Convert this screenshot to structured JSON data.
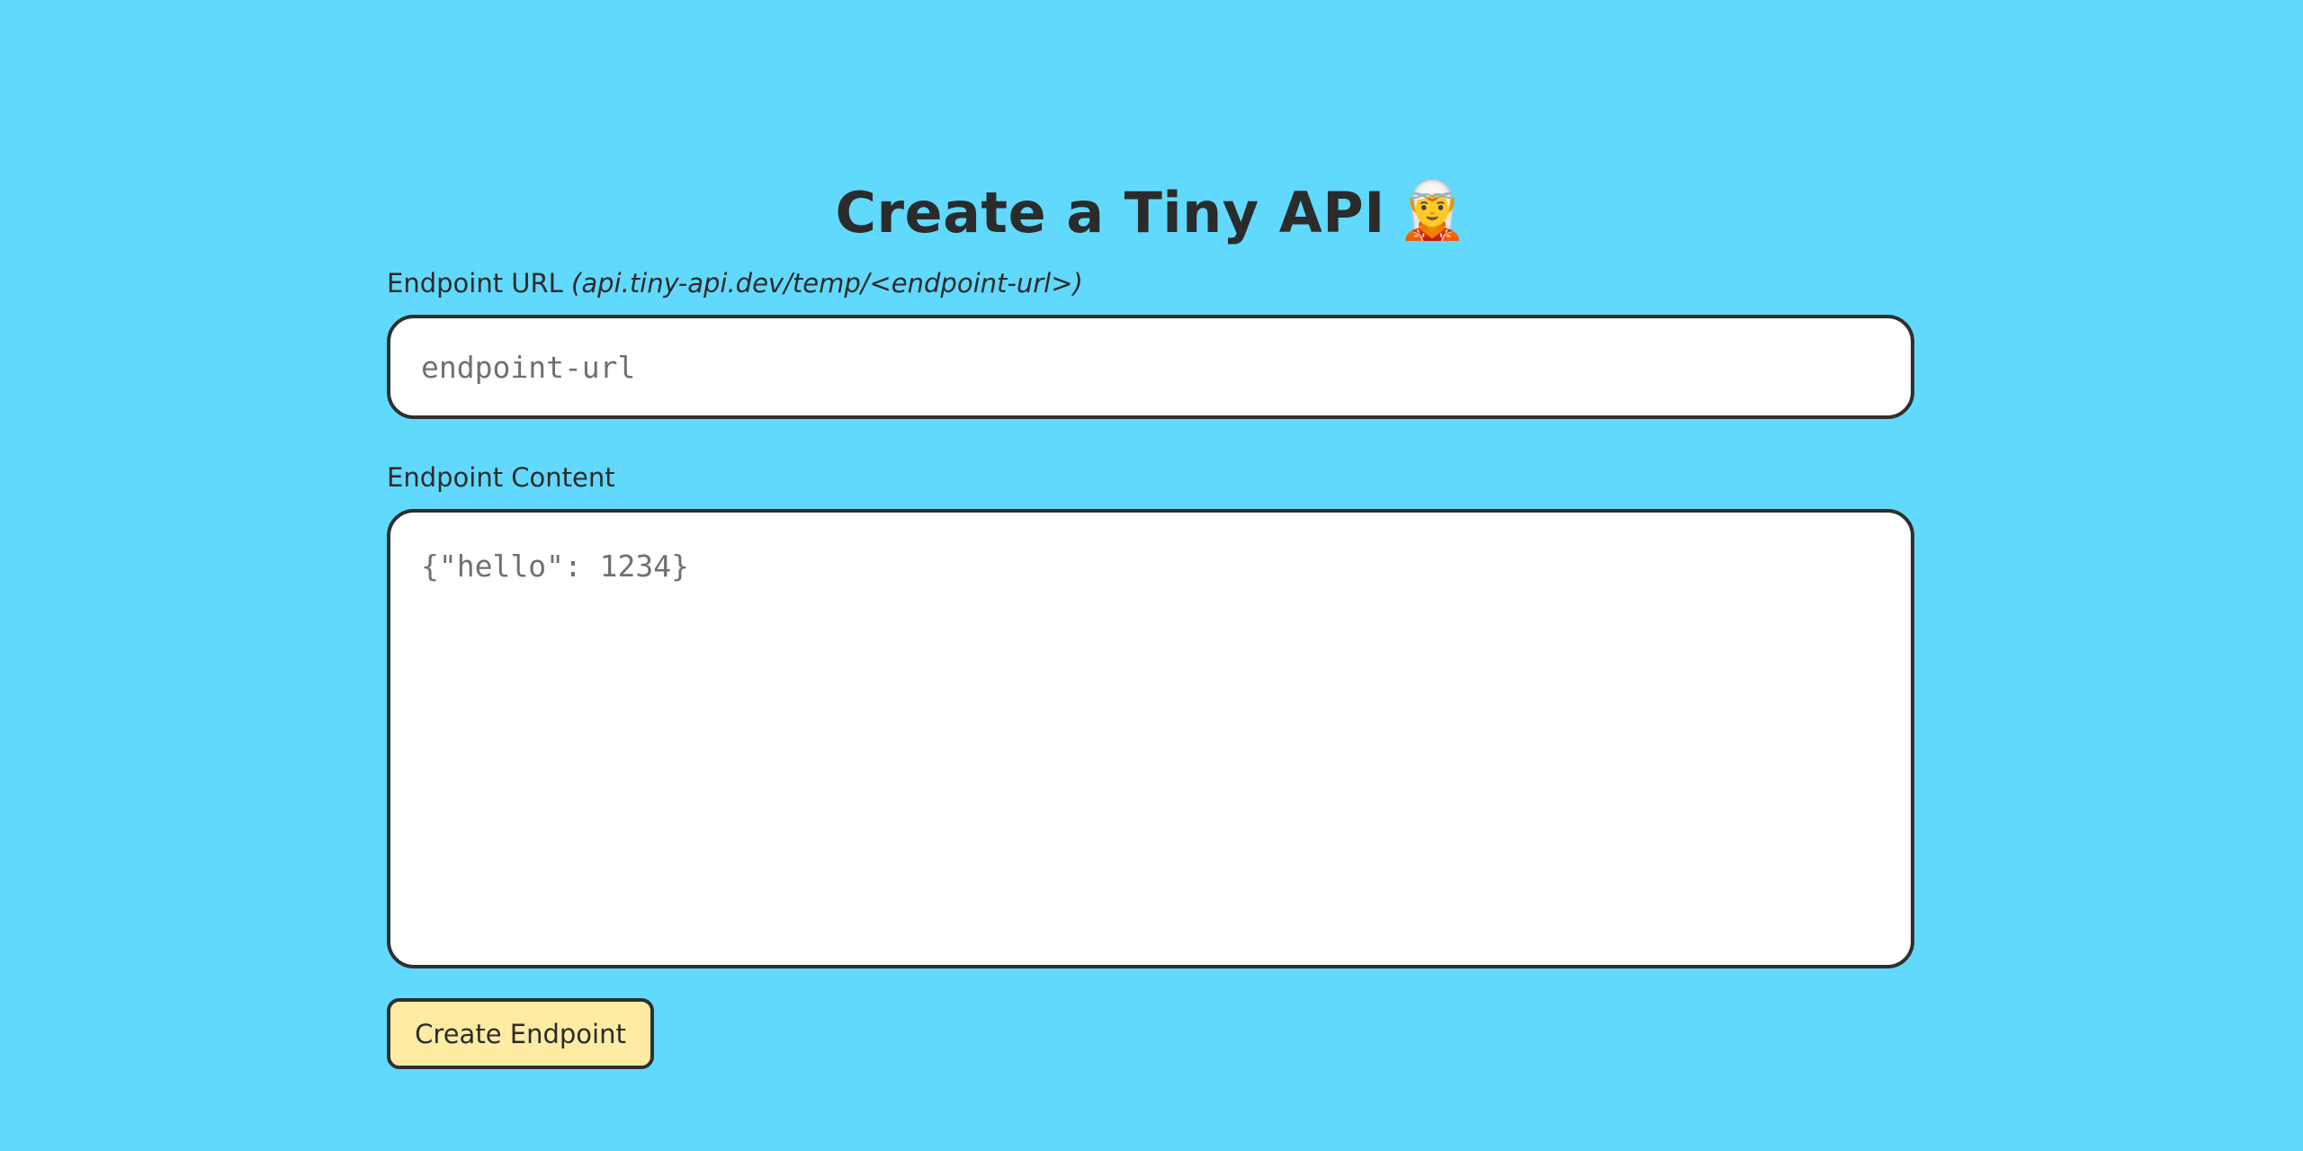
{
  "header": {
    "title": "Create a Tiny API",
    "emoji": "🧝",
    "emoji_icon": "elf-icon"
  },
  "form": {
    "url_label": "Endpoint URL",
    "url_hint": "(api.tiny-api.dev/temp/<endpoint-url>)",
    "url_value": "",
    "url_placeholder": "endpoint-url",
    "content_label": "Endpoint Content",
    "content_value": "",
    "content_placeholder": "{\"hello\": 1234}",
    "submit_label": "Create Endpoint"
  },
  "colors": {
    "background": "#61d9fc",
    "button": "#feeca3",
    "border": "#2f2f2f",
    "text": "#2b2b2b"
  }
}
